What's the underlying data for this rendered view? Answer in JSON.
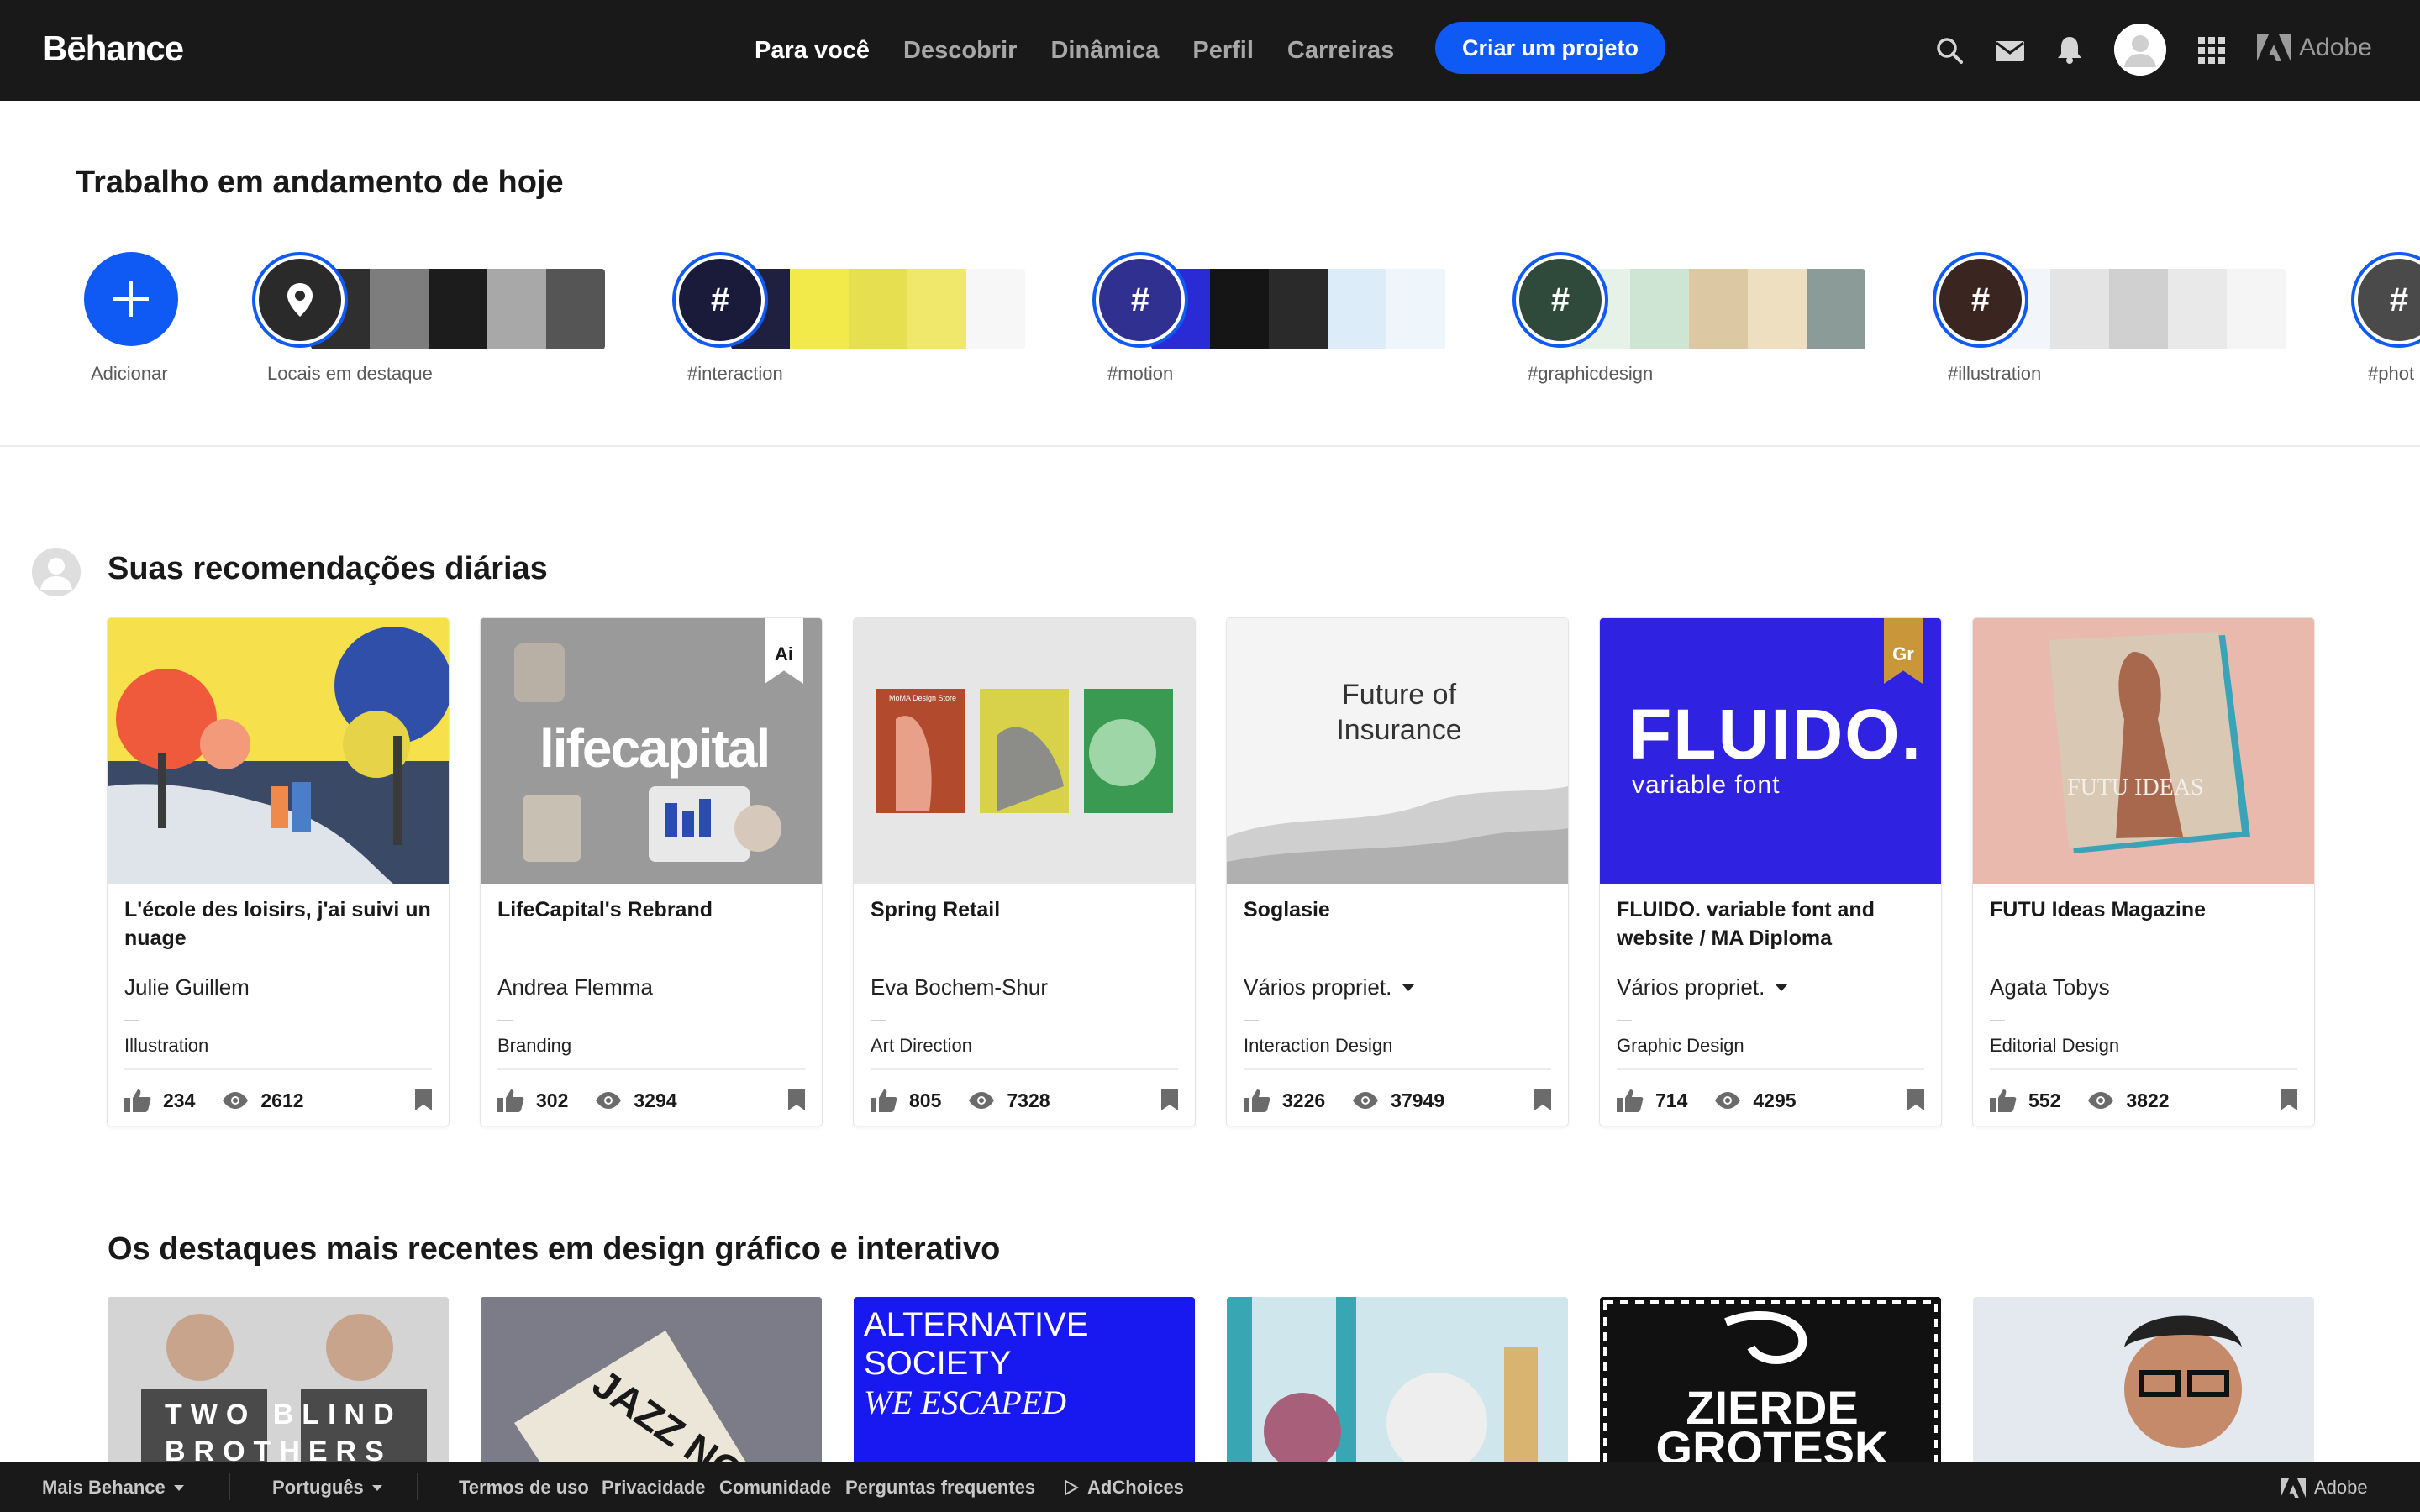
{
  "header": {
    "logo": "Bēhance",
    "nav": [
      "Para você",
      "Descobrir",
      "Dinâmica",
      "Perfil",
      "Carreiras"
    ],
    "active_nav": "Para você",
    "create_button": "Criar um projeto",
    "adobe_label": "Adobe",
    "icons": [
      "search-icon",
      "mail-icon",
      "bell-icon",
      "avatar",
      "apps-grid-icon",
      "adobe-logo-icon"
    ]
  },
  "wip": {
    "title": "Trabalho em andamento de hoje",
    "add_label": "Adicionar",
    "items": [
      {
        "label": "Locais em destaque",
        "icon": "location-pin-icon",
        "colors": [
          "#2b2b2b",
          "#6b6b6b",
          "#1e1e1e",
          "#9a9a9a",
          "#444"
        ]
      },
      {
        "label": "#interaction",
        "icon": "hashtag-icon",
        "colors": [
          "#1a1a3a",
          "#f3e948",
          "#ffffff",
          "#e7e351",
          "#f5f5f5"
        ]
      },
      {
        "label": "#motion",
        "icon": "hashtag-icon",
        "colors": [
          "#2a2ad0",
          "#111111",
          "#1e1e1e",
          "#d8eaf7",
          "#eaf4fb"
        ]
      },
      {
        "label": "#graphicdesign",
        "icon": "hashtag-icon",
        "colors": [
          "#e8f2ea",
          "#cfe6d3",
          "#d9c7a3",
          "#eedfbf",
          "#8a9b98"
        ]
      },
      {
        "label": "#illustration",
        "icon": "hashtag-icon",
        "colors": [
          "#3a2520",
          "#f2f5fa",
          "#e9e9e9",
          "#dcdcdc",
          "#f5f5f5"
        ]
      },
      {
        "label": "#phot",
        "icon": "hashtag-icon",
        "colors": [
          "#3b3b3b",
          "#777",
          "#999"
        ]
      }
    ]
  },
  "recommendations": {
    "title": "Suas recomendações diárias",
    "cards": [
      {
        "title": "L'école des loisirs, j'ai suivi un nuage",
        "owner": "Julie Guillem",
        "owner_dropdown": false,
        "field": "Illustration",
        "likes": "234",
        "views": "2612",
        "ribbon": "",
        "thumb_text": ""
      },
      {
        "title": "LifeCapital's Rebrand",
        "owner": "Andrea Flemma",
        "owner_dropdown": false,
        "field": "Branding",
        "likes": "302",
        "views": "3294",
        "ribbon": "Ai",
        "thumb_text": "lifecapital"
      },
      {
        "title": "Spring Retail",
        "owner": "Eva Bochem-Shur",
        "owner_dropdown": false,
        "field": "Art Direction",
        "likes": "805",
        "views": "7328",
        "ribbon": "",
        "thumb_text": "MoMA Design Store"
      },
      {
        "title": "Soglasie",
        "owner": "Vários propriet.",
        "owner_dropdown": true,
        "field": "Interaction Design",
        "likes": "3226",
        "views": "37949",
        "ribbon": "",
        "thumb_text": "Future of Insurance"
      },
      {
        "title": "FLUIDO. variable font and website / MA Diploma",
        "owner": "Vários propriet.",
        "owner_dropdown": true,
        "field": "Graphic Design",
        "likes": "714",
        "views": "4295",
        "ribbon": "Gr",
        "thumb_text": "FLUIDO."
      },
      {
        "title": "FUTU Ideas Magazine",
        "owner": "Agata Tobys",
        "owner_dropdown": false,
        "field": "Editorial Design",
        "likes": "552",
        "views": "3822",
        "ribbon": "",
        "thumb_text": "FUTU IDEAS"
      }
    ]
  },
  "highlights": {
    "title": "Os destaques mais recentes em design gráfico e interativo",
    "cards": [
      {
        "text": "TWO BLIND BROTHERS"
      },
      {
        "text": "JAZZ NO"
      },
      {
        "text": "ALTERNATIVE SOCIETY",
        "subtext": "WE ESCAPED"
      },
      {
        "text": ""
      },
      {
        "text": "ZIERDE GROTESK"
      },
      {
        "text": ""
      }
    ]
  },
  "footer": {
    "more_behance": "Mais Behance",
    "language": "Português",
    "links": [
      "Termos de uso",
      "Privacidade",
      "Comunidade",
      "Perguntas frequentes"
    ],
    "adchoices": "AdChoices",
    "adobe": "Adobe"
  }
}
